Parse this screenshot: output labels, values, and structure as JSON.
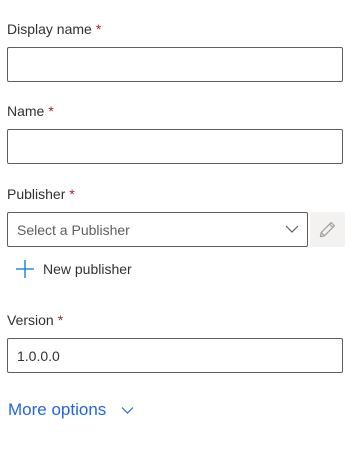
{
  "form": {
    "display_name": {
      "label": "Display name",
      "required_marker": "*",
      "value": ""
    },
    "name": {
      "label": "Name",
      "required_marker": "*",
      "value": ""
    },
    "publisher": {
      "label": "Publisher",
      "required_marker": "*",
      "placeholder": "Select a Publisher",
      "edit_icon": "pencil-icon",
      "new_publisher_label": "New publisher",
      "new_publisher_icon": "plus-icon"
    },
    "version": {
      "label": "Version",
      "required_marker": "*",
      "value": "1.0.0.0"
    },
    "more_options": {
      "label": "More options",
      "icon": "chevron-down-icon"
    }
  },
  "colors": {
    "text": "#323130",
    "required": "#a4262c",
    "border": "#605e5c",
    "link": "#2266e3",
    "accent": "#0078d4",
    "disabled_bg": "#f3f2f1"
  }
}
